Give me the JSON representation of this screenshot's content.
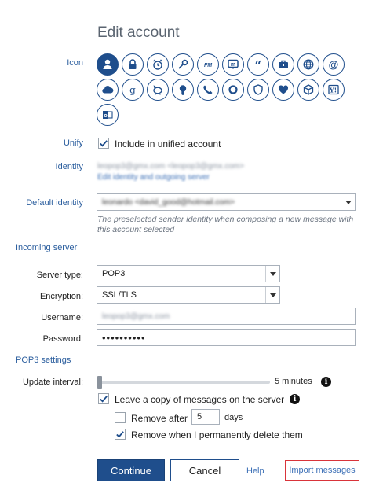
{
  "title": "Edit account",
  "icon_label": "Icon",
  "icons": [
    {
      "name": "person-icon",
      "selected": true
    },
    {
      "name": "lock-icon"
    },
    {
      "name": "alarm-clock-icon"
    },
    {
      "name": "key-icon"
    },
    {
      "name": "fm-radio-icon"
    },
    {
      "name": "chat-bubble-m-icon"
    },
    {
      "name": "quote-icon"
    },
    {
      "name": "briefcase-icon"
    },
    {
      "name": "globe-icon"
    },
    {
      "name": "at-sign-icon"
    },
    {
      "name": "cloud-icon"
    },
    {
      "name": "g-letter-icon"
    },
    {
      "name": "piggy-bank-icon"
    },
    {
      "name": "lightbulb-icon"
    },
    {
      "name": "phone-icon"
    },
    {
      "name": "ring-icon"
    },
    {
      "name": "shield-icon"
    },
    {
      "name": "heart-icon"
    },
    {
      "name": "cube-icon"
    },
    {
      "name": "yahoo-icon"
    },
    {
      "name": "outlook-icon"
    }
  ],
  "unify": {
    "label": "Unify",
    "checkbox_label": "Include in unified account",
    "checked": true
  },
  "identity": {
    "label": "Identity",
    "value": "leopop3@gmx.com <leopop3@gmx.com>",
    "edit_link": "Edit identity and outgoing server"
  },
  "default_identity": {
    "label": "Default identity",
    "value": "leonardo <david_good@hotmail.com>",
    "hint": "The preselected sender identity when composing a new message with this account selected"
  },
  "incoming_server": {
    "heading": "Incoming server"
  },
  "server_type": {
    "label": "Server type:",
    "value": "POP3"
  },
  "encryption": {
    "label": "Encryption:",
    "value": "SSL/TLS"
  },
  "username": {
    "label": "Username:",
    "value": "leopop3@gmx.com"
  },
  "password": {
    "label": "Password:",
    "value": "••••••••••"
  },
  "pop3_settings": {
    "heading": "POP3 settings"
  },
  "update_interval": {
    "label": "Update interval:",
    "value_text": "5 minutes",
    "level": 0.0
  },
  "leave_copy": {
    "label": "Leave a copy of messages on the server",
    "checked": true
  },
  "remove_after": {
    "label": "Remove after",
    "value": "5",
    "unit": "days",
    "checked": false
  },
  "remove_when_deleted": {
    "label": "Remove when I permanently delete them",
    "checked": true
  },
  "buttons": {
    "continue": "Continue",
    "cancel": "Cancel",
    "help": "Help",
    "import": "Import messages"
  },
  "colors": {
    "accent": "#1f4e8c",
    "link": "#3b6fb6",
    "highlight_border": "#d9343a"
  }
}
